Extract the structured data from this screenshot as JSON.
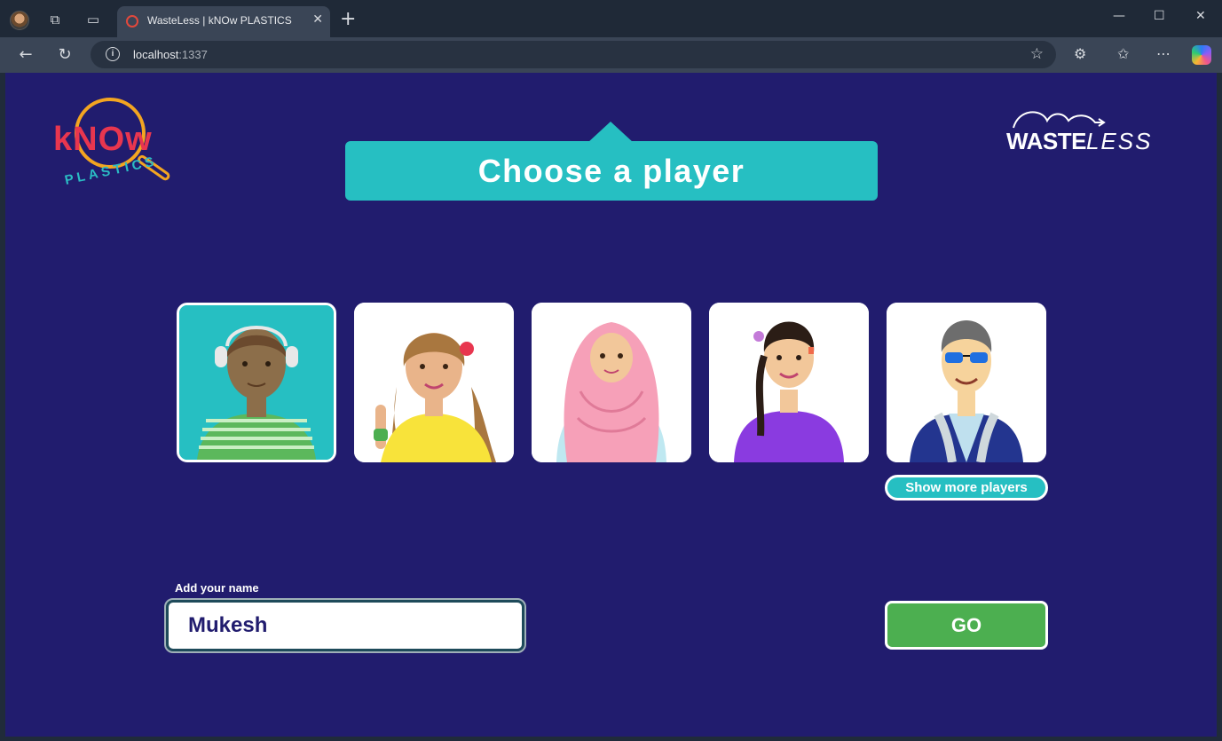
{
  "browser": {
    "tab_title": "WasteLess | kNOw PLASTICS",
    "tab_close": "✕",
    "new_tab": "+",
    "url_host": "localhost",
    "url_port": ":1337",
    "window_controls": {
      "minimize": "—",
      "maximize": "☐",
      "close": "✕"
    },
    "icons": [
      "profile-avatar",
      "workspaces-icon",
      "tab-actions-icon",
      "back-icon",
      "refresh-icon",
      "site-info-icon",
      "favorite-star-icon",
      "extensions-icon",
      "favorites-icon",
      "more-icon",
      "copilot-icon"
    ]
  },
  "page": {
    "logo_left": {
      "main": "kNOw",
      "sub": "PLASTICS"
    },
    "logo_right": {
      "main": "WASTE",
      "sub": "LESS"
    },
    "title": "Choose a player",
    "players": [
      {
        "id": "player-1",
        "selected": true
      },
      {
        "id": "player-2",
        "selected": false
      },
      {
        "id": "player-3",
        "selected": false
      },
      {
        "id": "player-4",
        "selected": false
      },
      {
        "id": "player-5",
        "selected": false
      }
    ],
    "show_more_label": "Show more players",
    "name_label": "Add your name",
    "name_value": "Mukesh",
    "go_label": "GO"
  },
  "colors": {
    "page_bg": "#211c6e",
    "accent_teal": "#26bfc2",
    "go_green": "#4caf50",
    "logo_red": "#e8364f",
    "logo_orange": "#f3a521"
  }
}
